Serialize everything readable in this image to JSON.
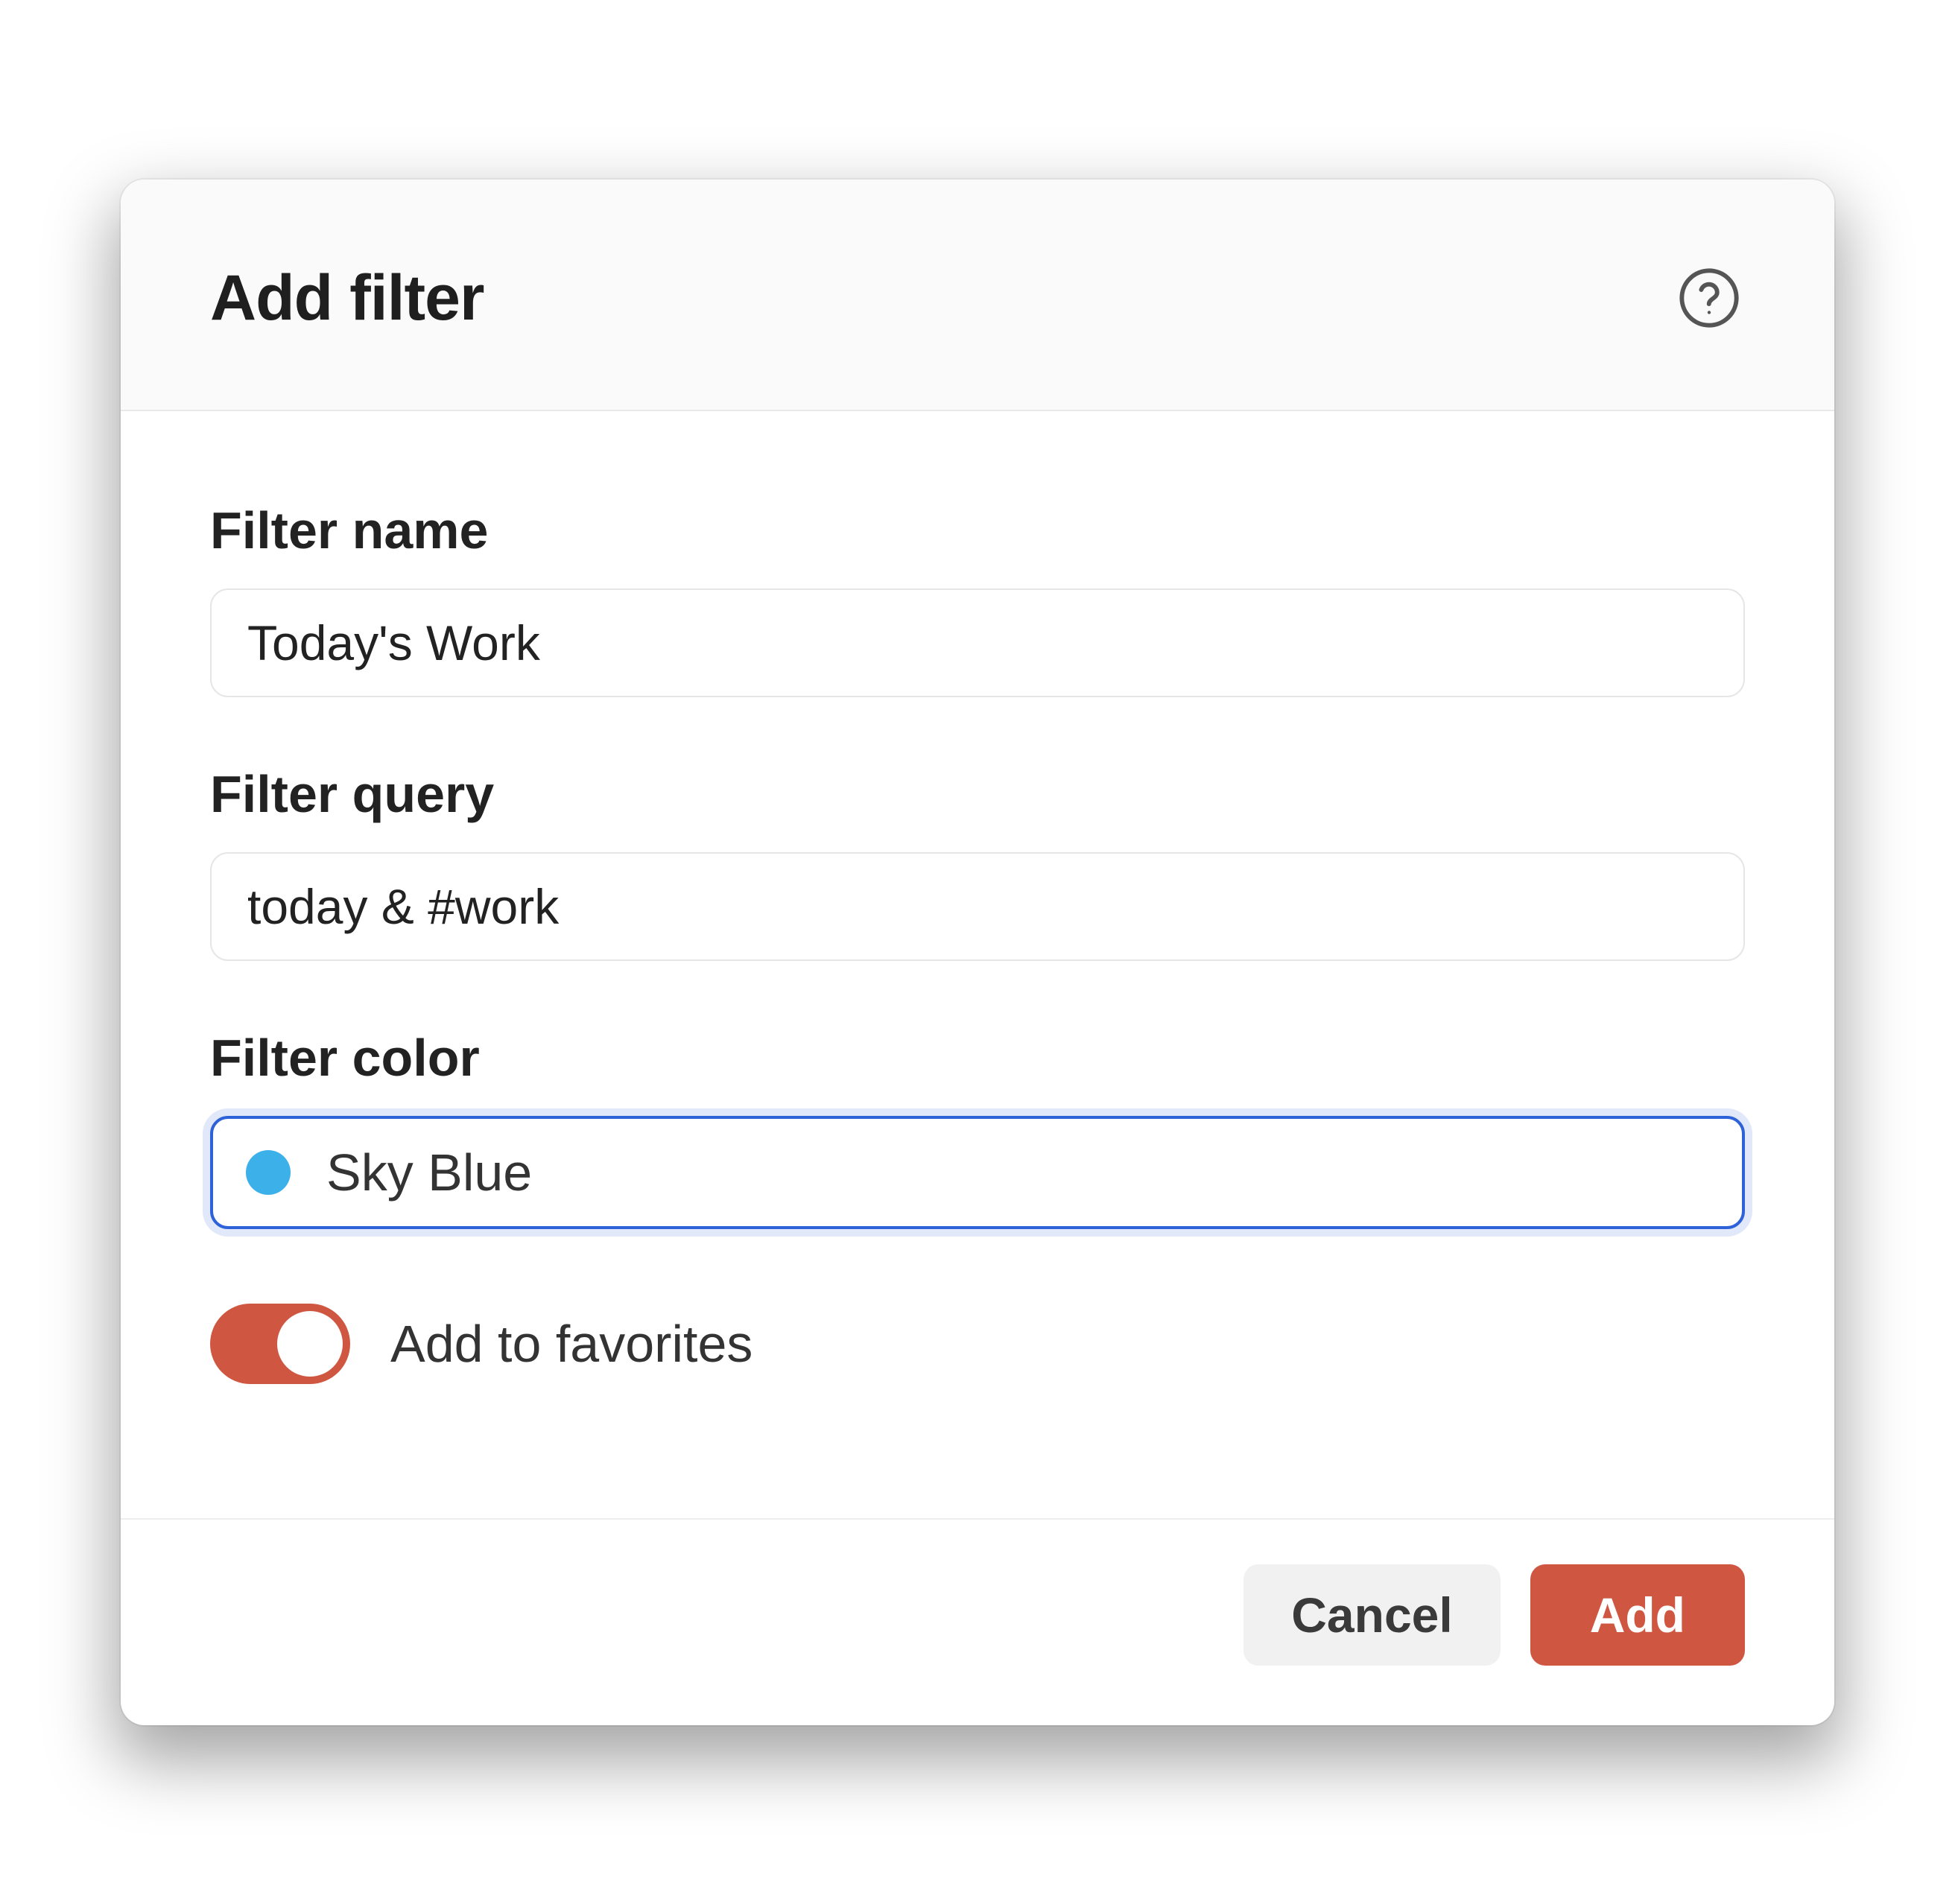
{
  "modal": {
    "title": "Add filter",
    "fields": {
      "name_label": "Filter name",
      "name_value": "Today's Work",
      "query_label": "Filter query",
      "query_value": "today & #work",
      "color_label": "Filter color",
      "color_value": "Sky Blue",
      "color_swatch_hex": "#3cb0e8"
    },
    "favorites": {
      "label": "Add to favorites",
      "enabled": true,
      "accent_hex": "#cf5742"
    },
    "buttons": {
      "cancel": "Cancel",
      "add": "Add"
    },
    "icons": {
      "help": "help-circle-icon"
    }
  }
}
